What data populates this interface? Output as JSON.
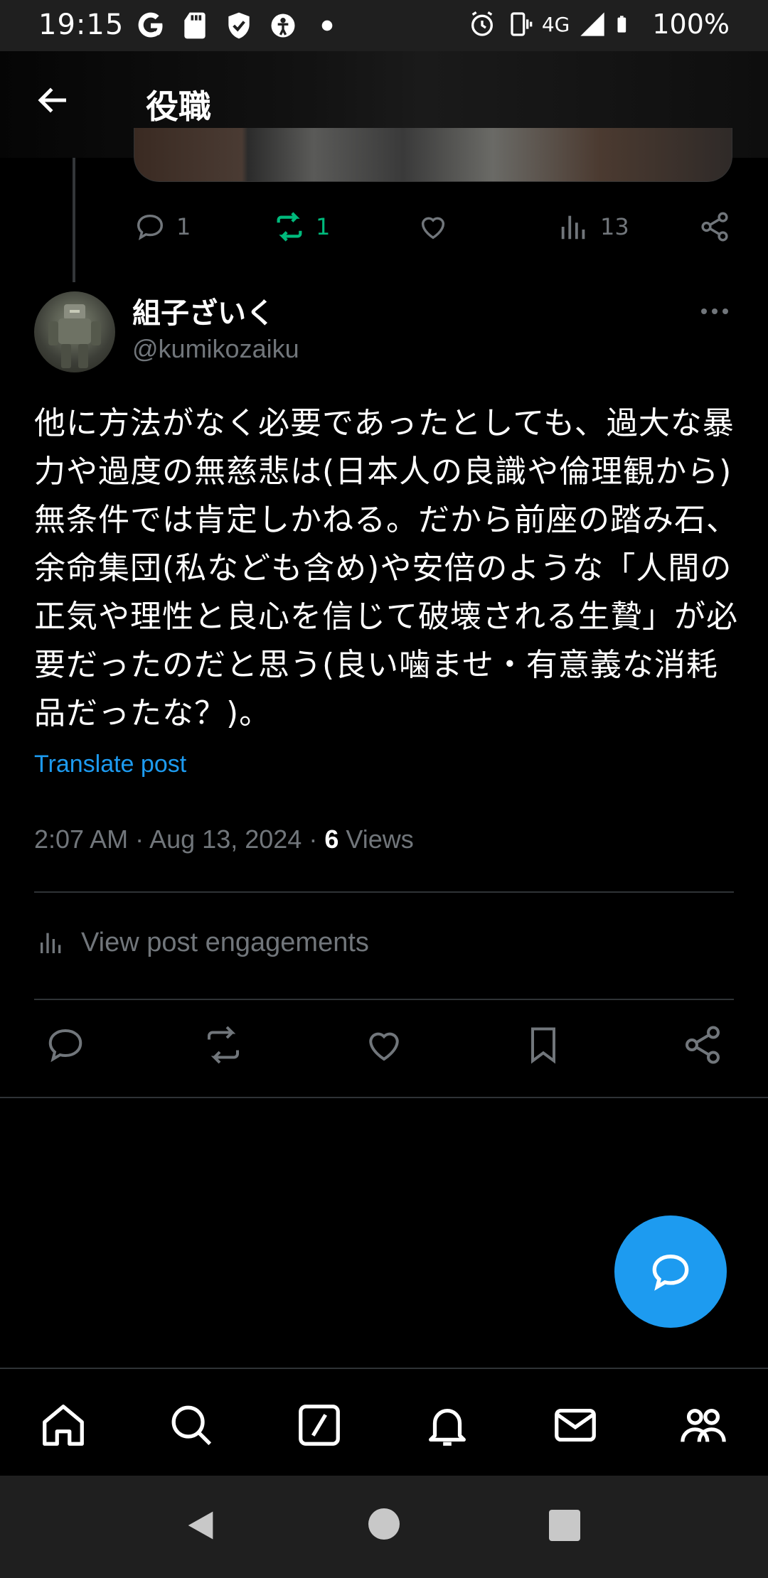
{
  "status_bar": {
    "time": "19:15",
    "network": "4G",
    "battery": "100%",
    "left_icons": [
      "google-icon",
      "sd-card-icon",
      "shield-icon",
      "accessibility-icon",
      "dot-icon"
    ],
    "right_icons": [
      "alarm-icon",
      "vibrate-icon",
      "signal-icon",
      "battery-icon"
    ]
  },
  "header": {
    "title": "役職"
  },
  "parent_post_actions": {
    "replies": "1",
    "reposts": "1",
    "views": "13"
  },
  "post": {
    "display_name": "組子ざいく",
    "handle": "@kumikozaiku",
    "text": "他に方法がなく必要であったとしても、過大な暴力や過度の無慈悲は(日本人の良識や倫理観から)無条件では肯定しかねる。だから前座の踏み石、余命集団(私なども含め)や安倍のような「人間の正気や理性と良心を信じて破壊される生贄」が必要だったのだと思う(良い噛ませ・有意義な消耗品だったな？)。",
    "translate_label": "Translate post",
    "time": "2:07 AM",
    "date": "Aug 13, 2024",
    "views_count": "6",
    "views_label": "Views",
    "separator": "·"
  },
  "engagements": {
    "label": "View post engagements"
  },
  "bottom_nav": [
    "home-icon",
    "search-icon",
    "grok-icon",
    "notifications-icon",
    "messages-icon",
    "communities-icon"
  ],
  "colors": {
    "accent": "#1d9bf0",
    "repost_green": "#00ba7c",
    "secondary_text": "#71767b",
    "divider": "#2f3336"
  }
}
